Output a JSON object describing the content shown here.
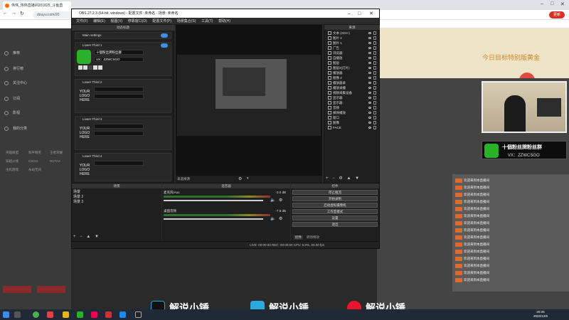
{
  "browser": {
    "tab_title": "伟伟_伟伟直播间201825_斗鱼直",
    "url": "douyu.com/20",
    "update_label": "更新"
  },
  "obs": {
    "title": "OBS 27.2.3 (64-bit, windows) - 配置文件: 未命名 - 场景: 未命名",
    "menu": [
      "文件(F)",
      "编辑(E)",
      "视图(V)",
      "停靠窗口(D)",
      "配置文件(P)",
      "场景集合(S)",
      "工具(T)",
      "帮助(H)"
    ],
    "dock_title": "动态标题",
    "main_settings": "Main settings",
    "lower_thirds": [
      {
        "name": "Lower Third 1",
        "line1": "十個粉丝牌粉丝群",
        "line2": "VX：ZZWCSGO"
      },
      {
        "name": "Lower Third 2",
        "line1": "",
        "line2": ""
      },
      {
        "name": "Lower Third 3",
        "line1": "",
        "line2": ""
      },
      {
        "name": "Lower Third 4",
        "line1": "",
        "line2": ""
      }
    ],
    "logo_text": "YOUR LOGO HERE",
    "preview_label": "未选择源",
    "sources_title": "来源",
    "sources": [
      "文本 (GDI+)",
      "图片 2",
      "图片 1",
      "广告",
      "浏览器",
      "自播放",
      "图层",
      "图层2(灯片)",
      "播放器",
      "图像 2",
      "播放器录",
      "播放录播",
      "视频采集设备",
      "显示器",
      "显示器",
      "音频",
      "媒体播放",
      "窗口",
      "图像",
      "FACE"
    ],
    "scenes_title": "场景",
    "scenes": [
      "场景",
      "场景 2",
      "场景 3"
    ],
    "mixer_title": "混音器",
    "mixer": [
      {
        "name": "桌面音频",
        "db": "-7.8 dB"
      },
      {
        "name": "麦克风/Aux",
        "db": "-3.0 dB"
      }
    ],
    "controls_title": "控件",
    "controls": [
      "停止推流",
      "开始录制",
      "启动虚拟摄像机",
      "工作室模式",
      "设置",
      "退出"
    ],
    "tab_controls": "控件",
    "tab_transitions": "转场特效",
    "status": "LIVE: 00:00:00    REC: 00:00:00    CPU: 5.0%, 60.00 fps"
  },
  "douyu": {
    "sidebar": [
      "推荐",
      "排行榜",
      "关注中心",
      "订阅",
      "影视",
      "我的分类"
    ],
    "subcats": [
      "英雄联盟",
      "和平精英",
      "王者荣耀",
      "穿越火线",
      "CSGO",
      "DOTA2",
      "主机游戏",
      "永劫无间"
    ],
    "chat": [
      "欢迎来到本直播间",
      "欢迎来到本直播间",
      "欢迎来到本直播间",
      "欢迎来到本直播间",
      "欢迎来到本直播间",
      "欢迎来到本直播间",
      "欢迎来到本直播间",
      "欢迎来到本直播间",
      "欢迎来到本直播间",
      "欢迎来到本直播间",
      "欢迎来到本直播间",
      "欢迎来到本直播间",
      "欢迎来到本直播间",
      "欢迎来到本直播间",
      "欢迎来到本直播间"
    ],
    "banner_line1": "十個粉丝牌粉丝群",
    "banner_line2": "VX：ZZWCSGO",
    "top_text": "今日目标特别版黄金"
  },
  "watermarks": [
    "解说小锤",
    "解说小锤",
    "解说小锤"
  ],
  "taskbar": {
    "time": "20:25",
    "date": "2022/12/5"
  }
}
